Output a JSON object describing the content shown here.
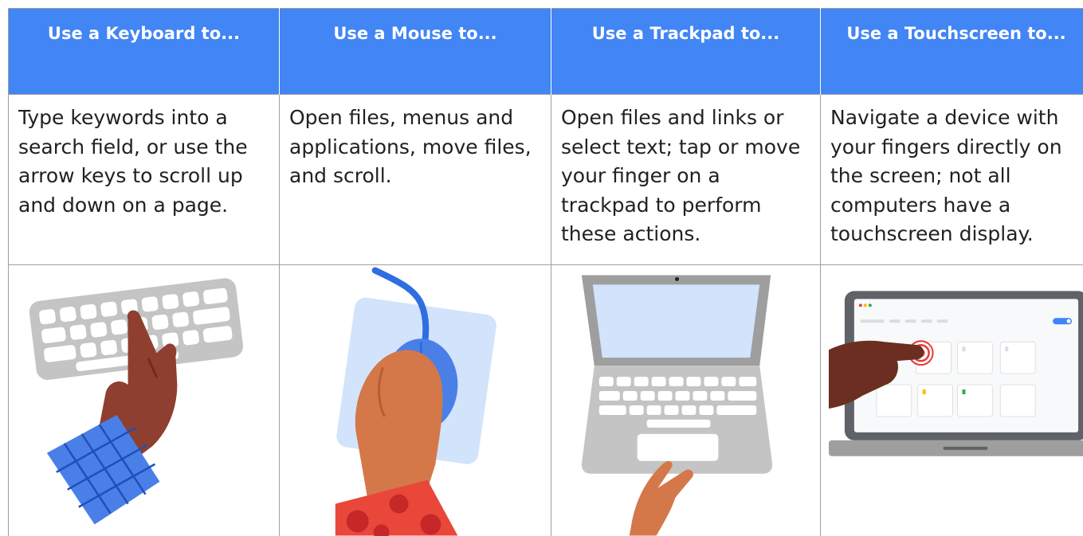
{
  "table": {
    "columns": [
      {
        "header": "Use a Keyboard to...",
        "description": "Type keywords into a search field, or use the arrow keys to scroll up and down on a page.",
        "illustration": "keyboard-hand-illustration"
      },
      {
        "header": "Use a Mouse to...",
        "description": "Open files, menus and applications, move files, and scroll.",
        "illustration": "mouse-hand-illustration"
      },
      {
        "header": "Use a Trackpad to...",
        "description": "Open files and links or select text; tap or move your finger on a trackpad to perform these actions.",
        "illustration": "laptop-trackpad-illustration"
      },
      {
        "header": "Use a Touchscreen to...",
        "description": "Navigate a device with your fingers directly on the screen; not all computers have a touchscreen display.",
        "illustration": "touchscreen-laptop-illustration"
      }
    ]
  },
  "colors": {
    "header_bg": "#4285f4",
    "header_text": "#ffffff",
    "body_text": "#202124",
    "border": "#9e9e9e",
    "keyboard_gray": "#c4c4c4",
    "skin_dark": "#8e3f30",
    "skin_medium": "#d4784a",
    "skin_darkest": "#6b2e20",
    "sleeve_blue": "#4a7fe8",
    "sleeve_red": "#e8473a",
    "mousepad_blue": "#d2e3fc",
    "mouse_blue": "#4a7fe8",
    "laptop_gray": "#9e9e9e",
    "screen_blue": "#d2e3fc",
    "touch_red": "#e53935"
  }
}
